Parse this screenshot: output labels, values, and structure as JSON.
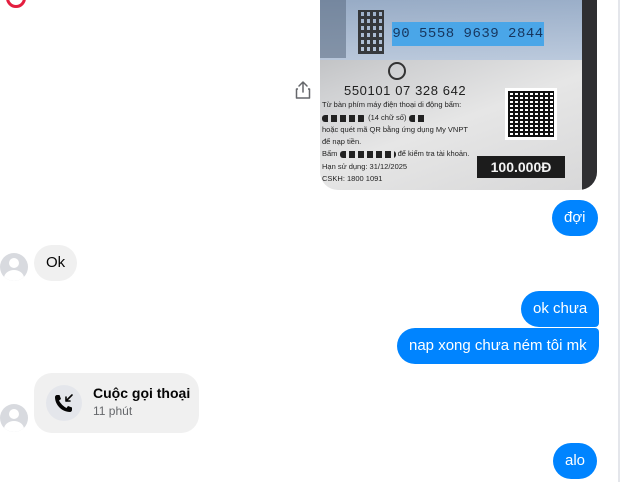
{
  "photo": {
    "serial": "90 5558 9639 2844",
    "card_code": "550101 07 328 642",
    "line1": "Từ bàn phím máy điện thoại di động bấm:",
    "line2": "(14 chữ số)",
    "line3": "hoặc quét mã QR bằng ứng dụng My VNPT",
    "line4": "để nạp tiền.",
    "line5_prefix": "Bấm",
    "line5_suffix": "để kiểm tra tài khoản.",
    "expiry": "Hạn sử dụng: 31/12/2025",
    "cskh": "CSKH:",
    "hotline": "1800 1091",
    "price": "100.000Đ"
  },
  "messages": {
    "m1": "đợi",
    "m2": "Ok",
    "m3": "ok chưa",
    "m4": "nap xong chưa ném tôi mk",
    "m5": "alo"
  },
  "call": {
    "title": "Cuộc gọi thoại",
    "time": "11 phút"
  },
  "colors": {
    "outgoing_bubble": "#0084ff",
    "incoming_bubble": "#f0f0f0"
  },
  "icons": [
    "share-icon",
    "phone-incoming-icon",
    "avatar-placeholder-icon"
  ]
}
